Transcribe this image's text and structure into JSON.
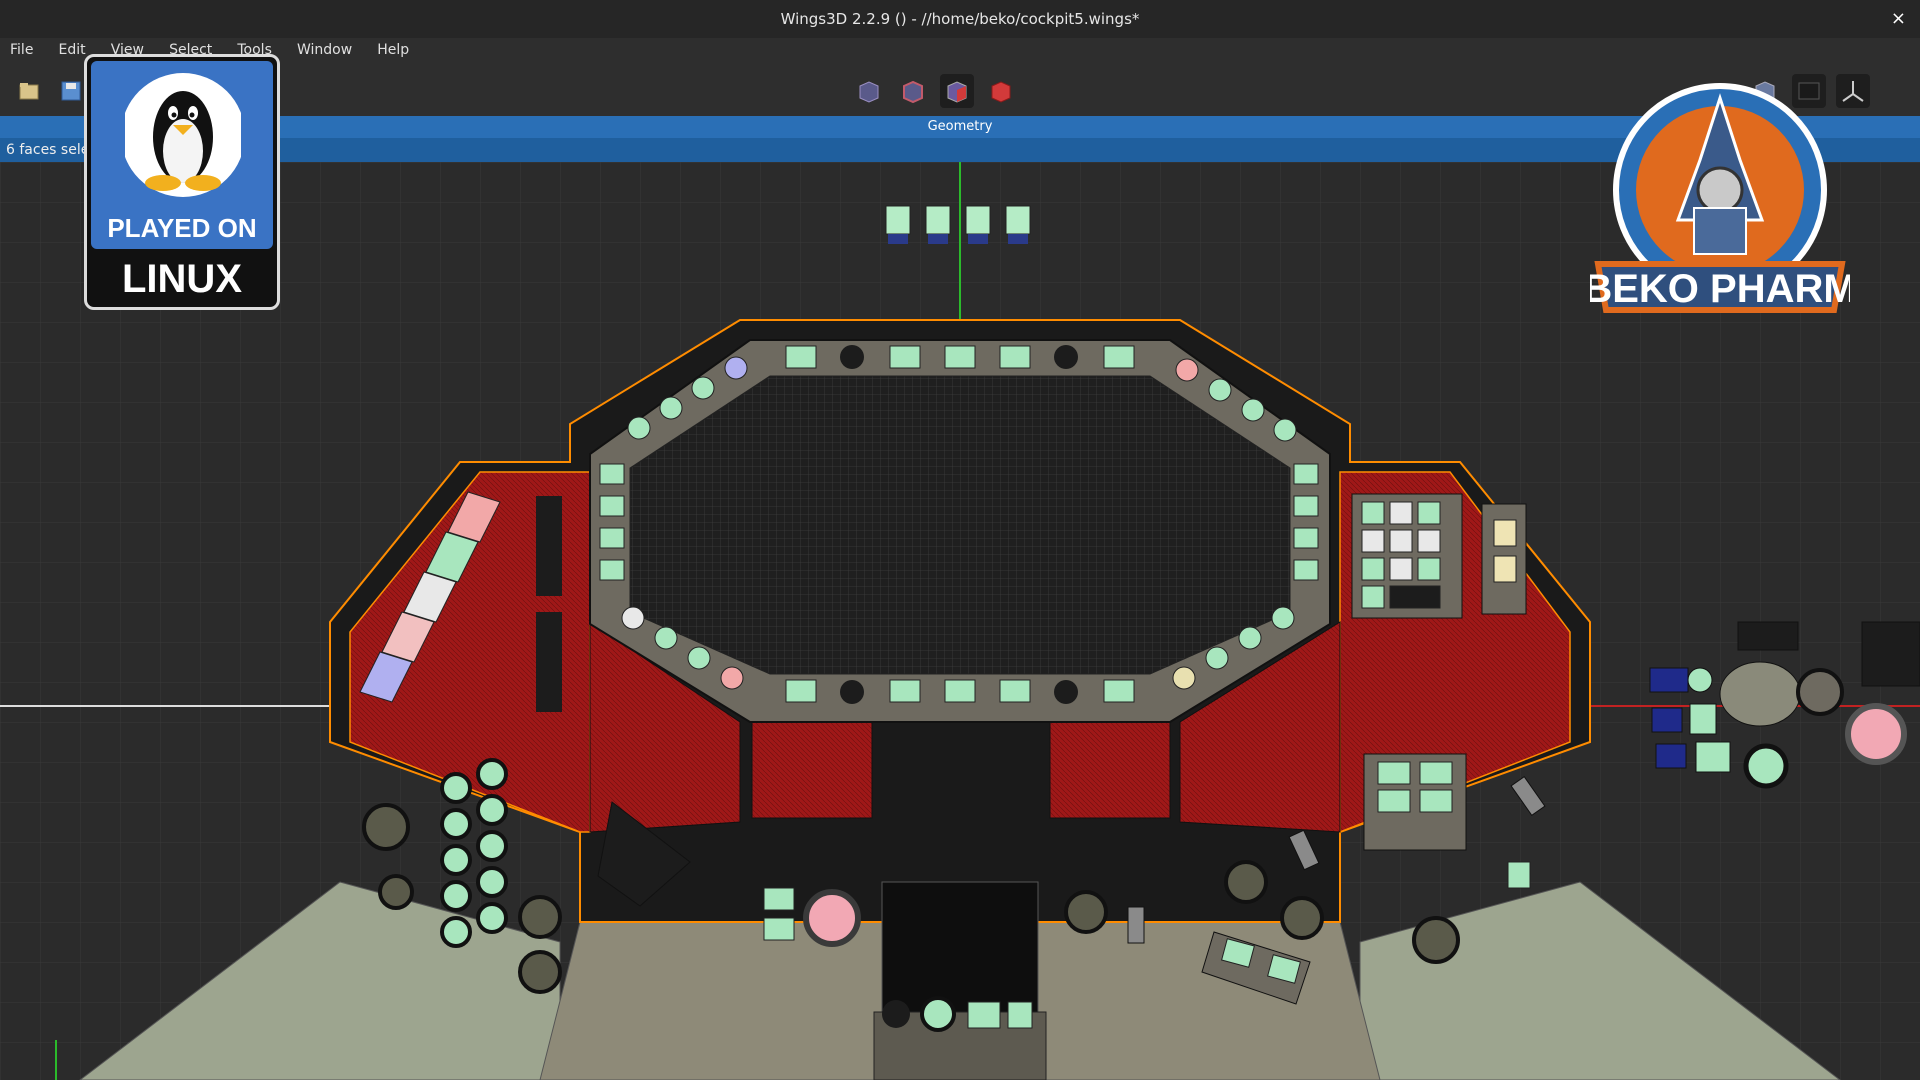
{
  "window": {
    "title": "Wings3D 2.2.9 () - //home/beko/cockpit5.wings*",
    "close_label": "×"
  },
  "menu": [
    "File",
    "Edit",
    "View",
    "Select",
    "Tools",
    "Window",
    "Help"
  ],
  "toolbar": {
    "selection_modes": [
      "vertex-mode-icon",
      "edge-mode-icon",
      "face-mode-icon",
      "object-mode-icon"
    ],
    "active_mode_index": 2
  },
  "geometry_bar": {
    "label": "Geometry"
  },
  "info": {
    "status": "6 faces selected"
  },
  "overlays": {
    "badge_line1": "PLAYED ON",
    "badge_line2": "LINUX",
    "logo_text": "BEKO PHARM"
  },
  "colors": {
    "viewport_bg": "#2b2b2b",
    "accent_blue": "#2a6fb6",
    "selection_red": "#9e1c1c",
    "selection_edge": "#ff8c00",
    "light_green": "#a8e6be"
  }
}
